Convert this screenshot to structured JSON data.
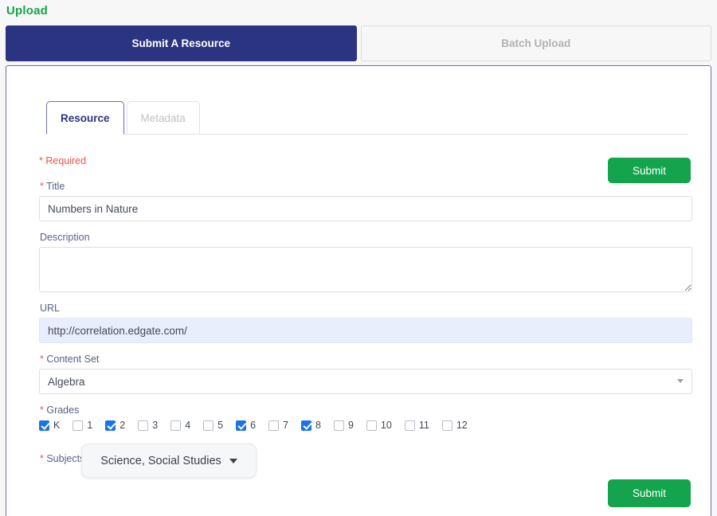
{
  "header": {
    "title": "Upload"
  },
  "top_tabs": [
    {
      "label": "Submit A Resource",
      "active": true
    },
    {
      "label": "Batch Upload",
      "active": false
    }
  ],
  "inner_tabs": [
    {
      "label": "Resource",
      "active": true
    },
    {
      "label": "Metadata",
      "active": false
    }
  ],
  "form": {
    "required_note": "* Required",
    "title": {
      "label_star": "*",
      "label": " Title",
      "value": "Numbers in Nature",
      "placeholder": ""
    },
    "description": {
      "label": "Description",
      "value": "",
      "placeholder": ""
    },
    "url": {
      "label": "URL",
      "value": "http://correlation.edgate.com/",
      "placeholder": ""
    },
    "content_set": {
      "label_star": "*",
      "label": " Content Set",
      "value": "Algebra"
    },
    "grades": {
      "label_star": "*",
      "label": " Grades",
      "items": [
        {
          "label": "K",
          "checked": true
        },
        {
          "label": "1",
          "checked": false
        },
        {
          "label": "2",
          "checked": true
        },
        {
          "label": "3",
          "checked": false
        },
        {
          "label": "4",
          "checked": false
        },
        {
          "label": "5",
          "checked": false
        },
        {
          "label": "6",
          "checked": true
        },
        {
          "label": "7",
          "checked": false
        },
        {
          "label": "8",
          "checked": true
        },
        {
          "label": "9",
          "checked": false
        },
        {
          "label": "10",
          "checked": false
        },
        {
          "label": "11",
          "checked": false
        },
        {
          "label": "12",
          "checked": false
        }
      ]
    },
    "subjects": {
      "label_star": "*",
      "label": " Subjects",
      "value": "Science, Social Studies"
    }
  },
  "buttons": {
    "submit_top": "Submit",
    "submit_bottom": "Submit"
  },
  "colors": {
    "brand_navy": "#2b3480",
    "accent_green": "#14a44d",
    "title_green": "#16a34a",
    "required_red": "#f2524e",
    "checkbox_blue": "#1a73e8",
    "autofill_blue": "#e8eefc"
  }
}
